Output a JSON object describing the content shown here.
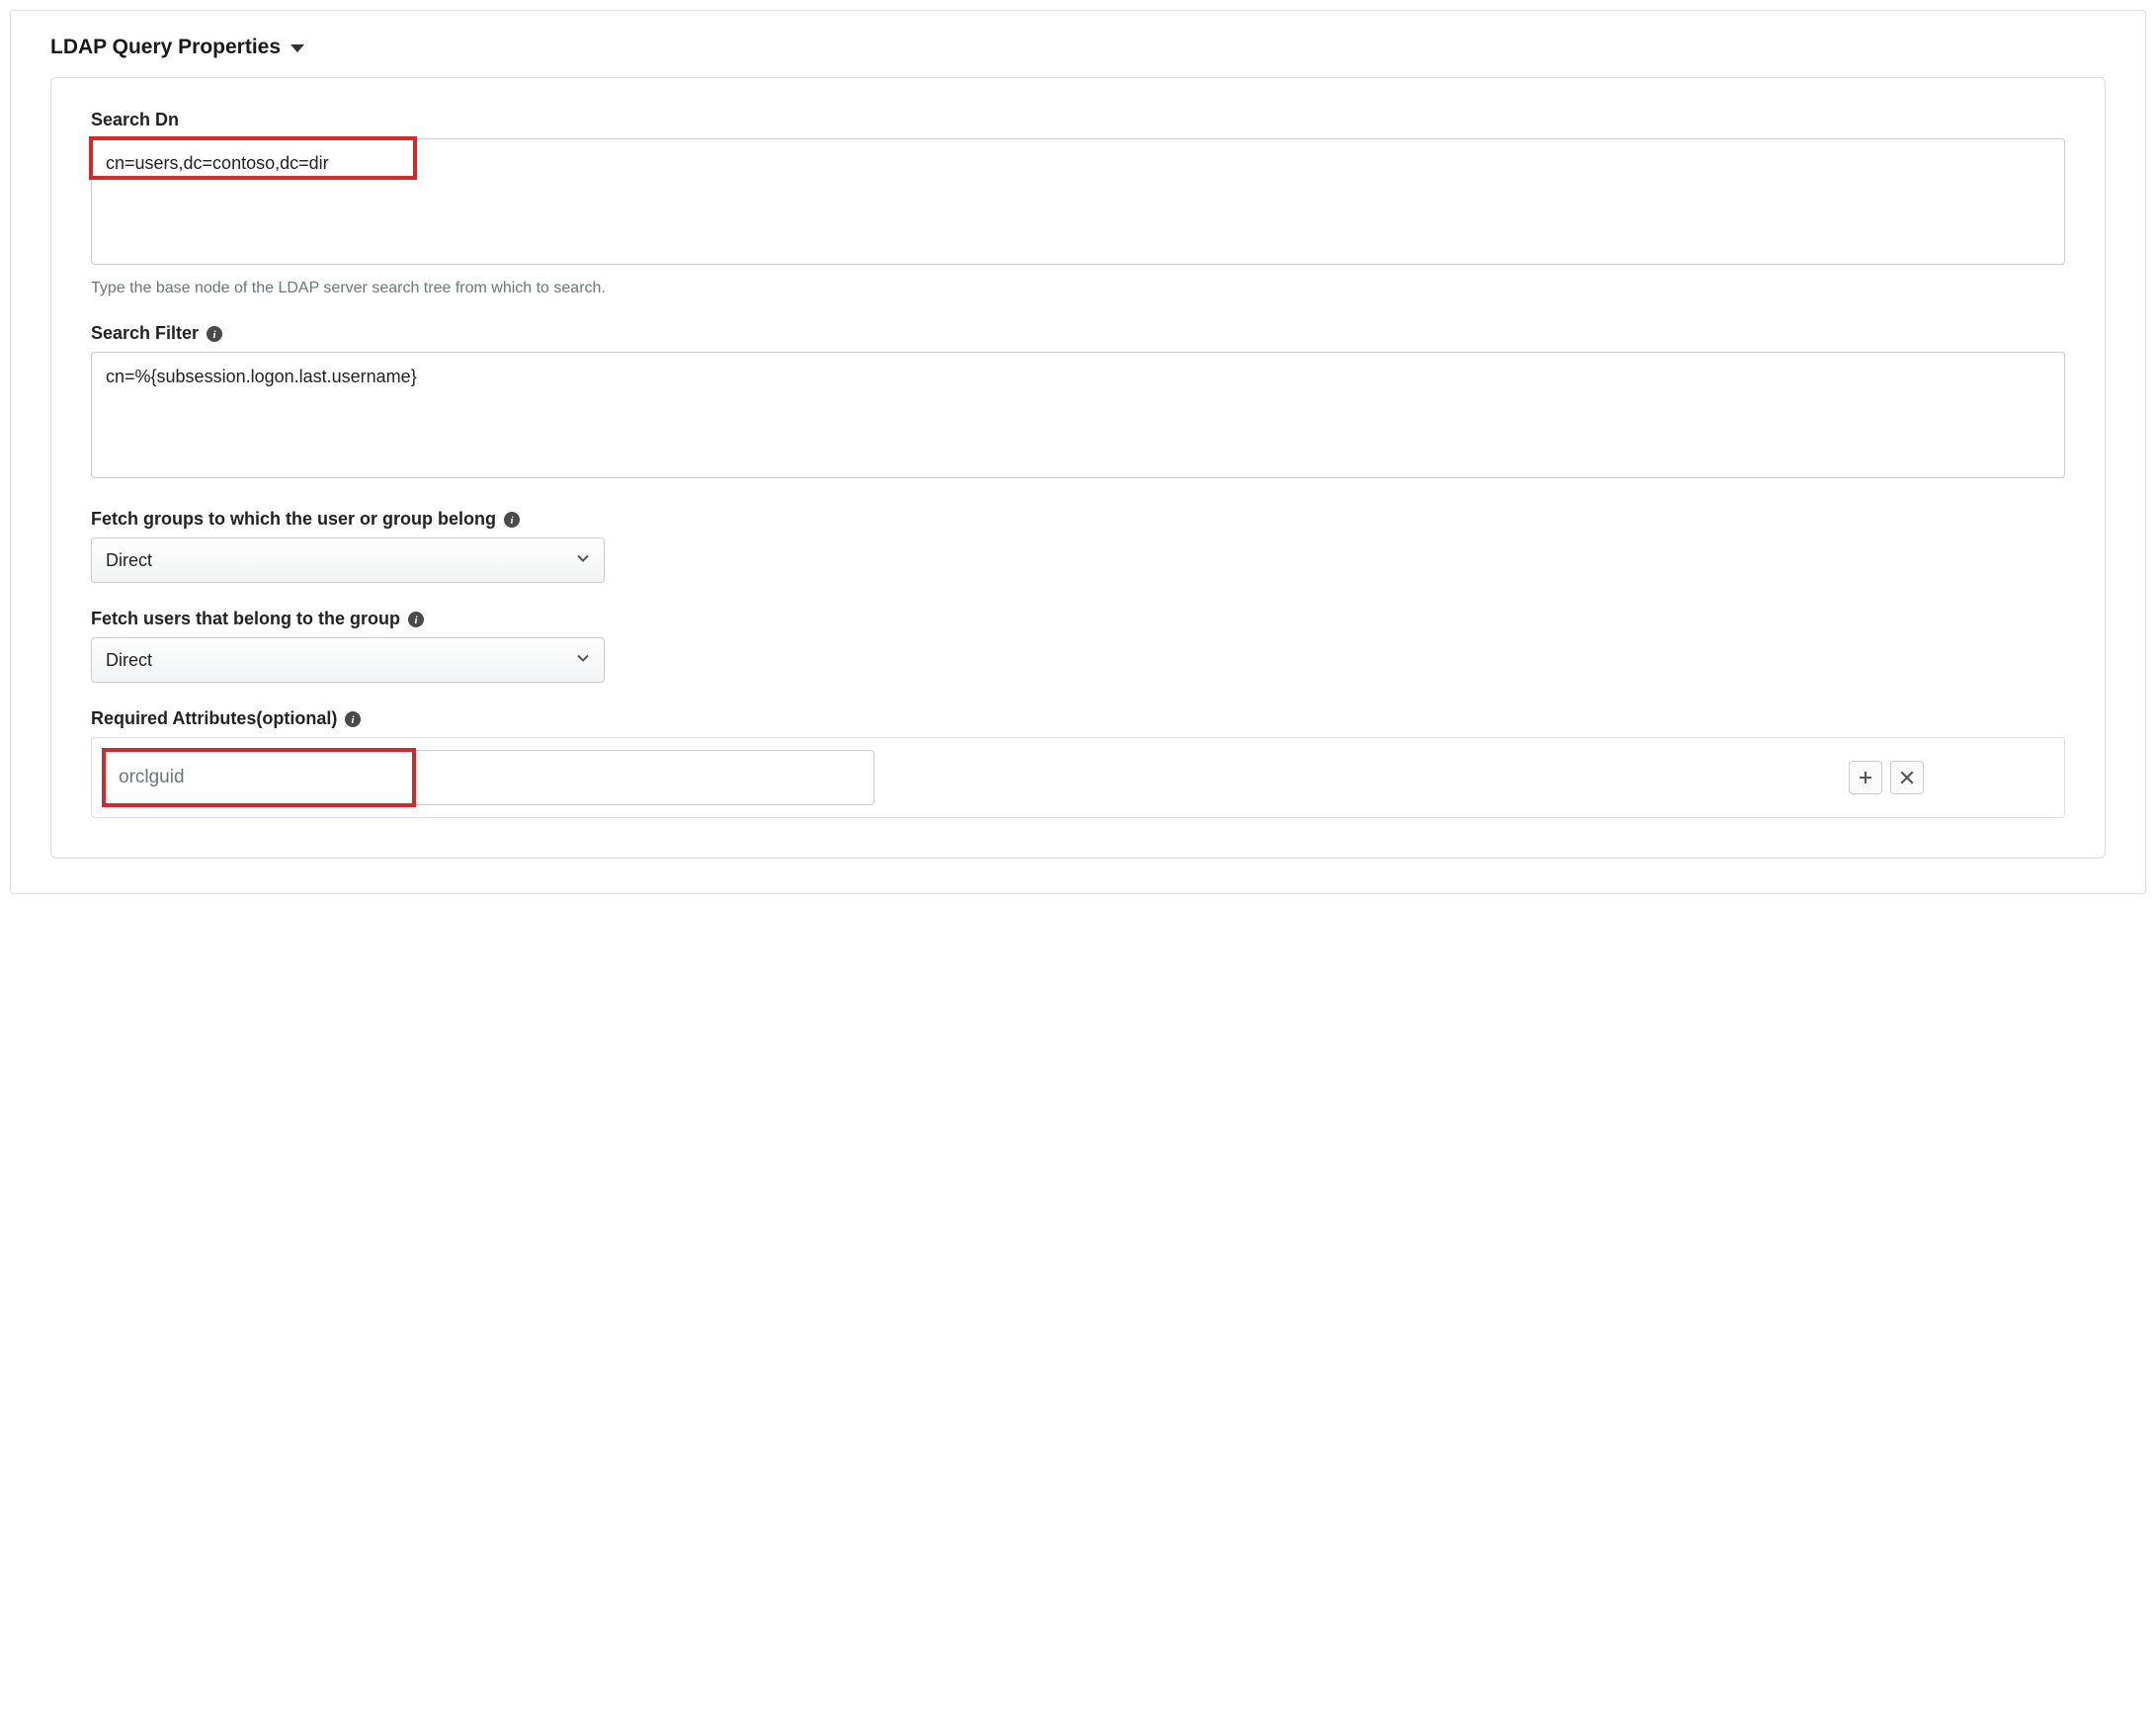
{
  "section": {
    "title": "LDAP Query Properties"
  },
  "fields": {
    "searchDn": {
      "label": "Search Dn",
      "value": "cn=users,dc=contoso,dc=dir",
      "help": "Type the base node of the LDAP server search tree from which to search."
    },
    "searchFilter": {
      "label": "Search Filter",
      "value": "cn=%{subsession.logon.last.username}"
    },
    "fetchGroups": {
      "label": "Fetch groups to which the user or group belong",
      "value": "Direct"
    },
    "fetchUsers": {
      "label": "Fetch users that belong to the group",
      "value": "Direct"
    },
    "requiredAttrs": {
      "label": "Required Attributes(optional)",
      "value": "orclguid"
    }
  }
}
